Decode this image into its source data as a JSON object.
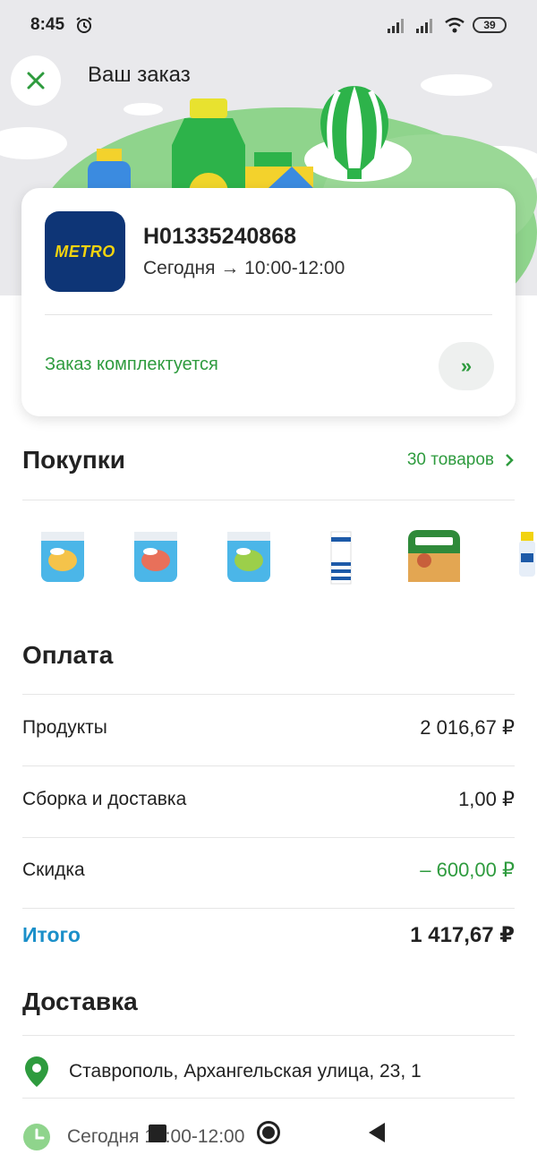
{
  "status_bar": {
    "time": "8:45",
    "battery": "39"
  },
  "header": {
    "title": "Ваш заказ"
  },
  "order": {
    "store_logo_text": "METRO",
    "number": "H01335240868",
    "delivery_time": "Сегодня → 10:00-12:00",
    "status": "Заказ комплектуется"
  },
  "purchases": {
    "title": "Покупки",
    "items_link": "30 товаров"
  },
  "payment": {
    "title": "Оплата",
    "rows": [
      {
        "label": "Продукты",
        "value": "2 016,67 ₽"
      },
      {
        "label": "Сборка и доставка",
        "value": "1,00 ₽"
      },
      {
        "label": "Скидка",
        "value": "– 600,00 ₽"
      }
    ],
    "total": {
      "label": "Итого",
      "value": "1 417,67 ₽"
    }
  },
  "delivery": {
    "title": "Доставка",
    "address": "Ставрополь, Архангельская улица, 23, 1",
    "time": "Сегодня 10:00-12:00"
  },
  "colors": {
    "accent_green": "#2e9b3e",
    "total_blue": "#1a8fc9",
    "metro_blue": "#0e3576",
    "metro_yellow": "#f2d30f"
  }
}
